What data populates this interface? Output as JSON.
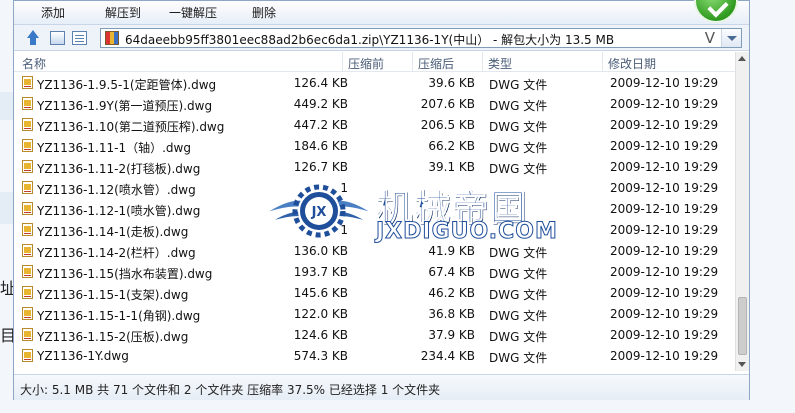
{
  "toolbar": {
    "add_label": "添加",
    "extract_to_label": "解压到",
    "one_click_extract_label": "一键解压",
    "delete_label": "删除"
  },
  "address": {
    "path": "64daeebb95ff3801eec88ad2b6ec6da1.zip\\YZ1136-1Y(中山） - 解包大小为 13.5 MB",
    "v_glyph": "V"
  },
  "columns": {
    "name": "名称",
    "size": "压缩前",
    "packed": "压缩后",
    "type": "类型",
    "modified": "修改日期"
  },
  "files": [
    {
      "name": "YZ1136-1.9.5-1(定距管体).dwg",
      "size": "126.4 KB",
      "packed": "39.6 KB",
      "type": "DWG 文件",
      "modified": "2009-12-10 19:29"
    },
    {
      "name": "YZ1136-1.9Y(第一道预压).dwg",
      "size": "449.2 KB",
      "packed": "207.6 KB",
      "type": "DWG 文件",
      "modified": "2009-12-10 19:29"
    },
    {
      "name": "YZ1136-1.10(第二道预压榨).dwg",
      "size": "447.2 KB",
      "packed": "206.5 KB",
      "type": "DWG 文件",
      "modified": "2009-12-10 19:29"
    },
    {
      "name": "YZ1136-1.11-1（轴）.dwg",
      "size": "184.6 KB",
      "packed": "66.2 KB",
      "type": "DWG 文件",
      "modified": "2009-12-10 19:29"
    },
    {
      "name": "YZ1136-1.11-2(打毯板).dwg",
      "size": "126.7 KB",
      "packed": "39.1 KB",
      "type": "DWG 文件",
      "modified": "2009-12-10 19:29"
    },
    {
      "name": "YZ1136-1.12(喷水管）.dwg",
      "size": "1",
      "packed": "",
      "type": "",
      "modified": "2009-12-10 19:29"
    },
    {
      "name": "YZ1136-1.12-1(喷水管).dwg",
      "size": "",
      "packed": "",
      "type": "",
      "modified": "2009-12-10 19:29"
    },
    {
      "name": "YZ1136-1.14-1(走板).dwg",
      "size": "1",
      "packed": "",
      "type": "",
      "modified": "2009-12-10 19:29"
    },
    {
      "name": "YZ1136-1.14-2(栏杆）.dwg",
      "size": "136.0 KB",
      "packed": "41.9 KB",
      "type": "DWG 文件",
      "modified": "2009-12-10 19:29"
    },
    {
      "name": "YZ1136-1.15(挡水布装置).dwg",
      "size": "193.7 KB",
      "packed": "67.4 KB",
      "type": "DWG 文件",
      "modified": "2009-12-10 19:29"
    },
    {
      "name": "YZ1136-1.15-1(支架).dwg",
      "size": "145.6 KB",
      "packed": "46.2 KB",
      "type": "DWG 文件",
      "modified": "2009-12-10 19:29"
    },
    {
      "name": "YZ1136-1.15-1-1(角钢).dwg",
      "size": "122.0 KB",
      "packed": "36.8 KB",
      "type": "DWG 文件",
      "modified": "2009-12-10 19:29"
    },
    {
      "name": "YZ1136-1.15-2(压板).dwg",
      "size": "124.6 KB",
      "packed": "37.9 KB",
      "type": "DWG 文件",
      "modified": "2009-12-10 19:29"
    },
    {
      "name": "YZ1136-1Y.dwg",
      "size": "574.3 KB",
      "packed": "234.4 KB",
      "type": "DWG 文件",
      "modified": "2009-12-10 19:29"
    }
  ],
  "status": {
    "text": "大小: 5.1 MB 共 71 个文件和 2 个文件夹 压缩率 37.5% 已经选择 1 个文件夹"
  },
  "watermark": {
    "title": "机械帝国",
    "subtitle": "JXDIGUO.COM",
    "emblem_text": "JX"
  },
  "background": {
    "frag1": "址",
    "frag2": "目录"
  },
  "colors": {
    "accent": "#3a78c8",
    "watermark_blue": "#1f4e9a"
  }
}
